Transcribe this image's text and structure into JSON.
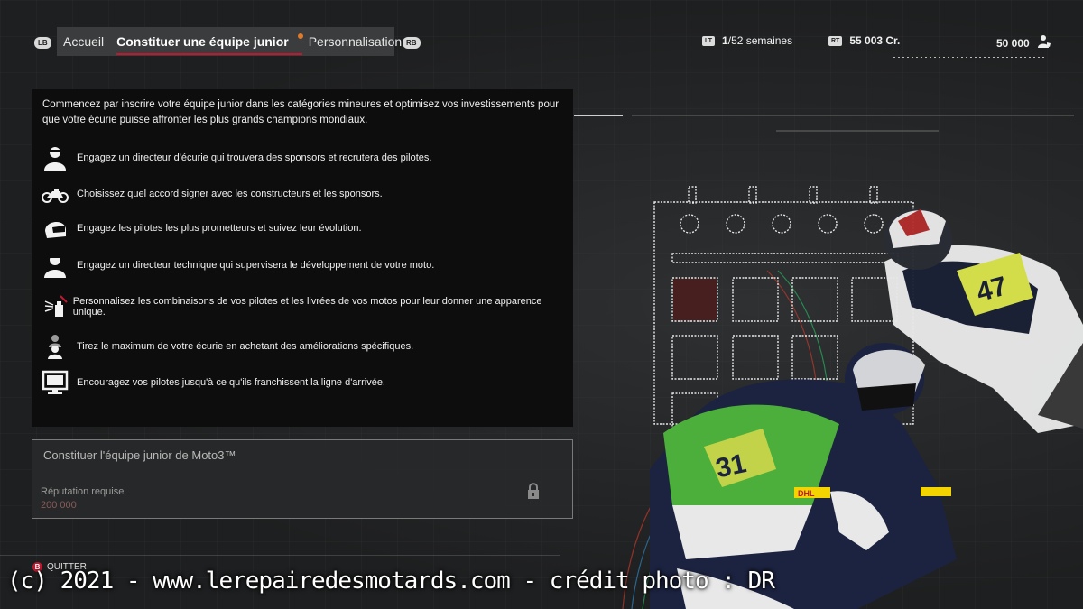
{
  "nav": {
    "lb": "LB",
    "rb": "RB",
    "tabs": [
      {
        "label": "Accueil"
      },
      {
        "label": "Constituer une équipe junior"
      },
      {
        "label": "Personnalisation"
      }
    ]
  },
  "stats": {
    "week_trigger": "LT",
    "week_current": "1",
    "week_rest": "/52 semaines",
    "credits_trigger": "RT",
    "credits": "55 003 Cr.",
    "reputation": "50 000"
  },
  "panel": {
    "intro": "Commencez par inscrire votre équipe junior dans les catégories mineures et optimisez vos investissements pour que votre écurie puisse affronter les plus grands champions mondiaux.",
    "features": [
      {
        "icon": "team-manager-icon",
        "text": "Engagez un directeur d'écurie qui trouvera des sponsors et recrutera des pilotes."
      },
      {
        "icon": "motorbike-icon",
        "text": "Choisissez quel accord signer avec les constructeurs et les sponsors."
      },
      {
        "icon": "rider-helmet-icon",
        "text": "Engagez les pilotes les plus prometteurs et suivez leur évolution."
      },
      {
        "icon": "technical-director-icon",
        "text": "Engagez un directeur technique qui supervisera le développement de votre moto."
      },
      {
        "icon": "paint-spray-icon",
        "text": "Personnalisez les combinaisons de vos pilotes et les livrées de vos motos pour leur donner une apparence unique."
      },
      {
        "icon": "upgrades-icon",
        "text": "Tirez le maximum de votre écurie en achetant des améliorations spécifiques."
      },
      {
        "icon": "monitor-icon",
        "text": "Encouragez vos pilotes jusqu'à ce qu'ils franchissent la ligne d'arrivée."
      }
    ]
  },
  "card": {
    "title": "Constituer l'équipe junior de Moto3™",
    "rep_label": "Réputation requise",
    "rep_value": "200 000"
  },
  "footer": {
    "quit_key": "B",
    "quit_label": "QUITTER",
    "watermark": "(c) 2021 - www.lerepairedesmotards.com  - crédit photo : DR"
  },
  "colors": {
    "accent_red": "#c0192f",
    "notification": "#e07a2b",
    "rider_green": "#4caf3c",
    "rider_navy": "#1c2340"
  }
}
